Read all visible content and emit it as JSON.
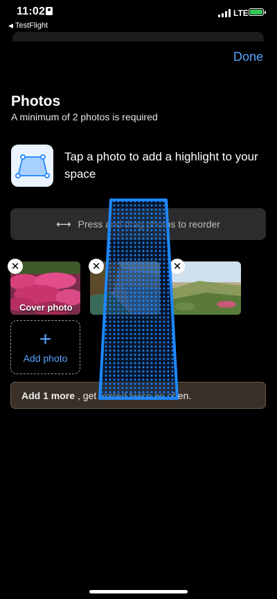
{
  "status_bar": {
    "time": "11:02",
    "back_app": "TestFlight",
    "network": "LTE"
  },
  "header": {
    "done_label": "Done"
  },
  "section": {
    "title": "Photos",
    "subtitle": "A minimum of 2 photos is required"
  },
  "highlight": {
    "icon": "highlight-frame-icon",
    "text": "Tap a photo to add a highlight to your space"
  },
  "reorder": {
    "icon": "left-right-arrow-icon",
    "text": "Press and drag photos to reorder"
  },
  "photos": [
    {
      "name": "pink-flowers-photo",
      "label": "Cover photo"
    },
    {
      "name": "coastline-photo",
      "label": ""
    },
    {
      "name": "dunes-photo",
      "label": ""
    }
  ],
  "add_photo": {
    "label": "Add photo"
  },
  "banner": {
    "bold": "Add 1 more",
    "rest": ", get rented twice as often."
  },
  "colors": {
    "accent": "#5aa4ff",
    "battery": "#35c759",
    "highlight_overlay": "#1e88ff"
  }
}
